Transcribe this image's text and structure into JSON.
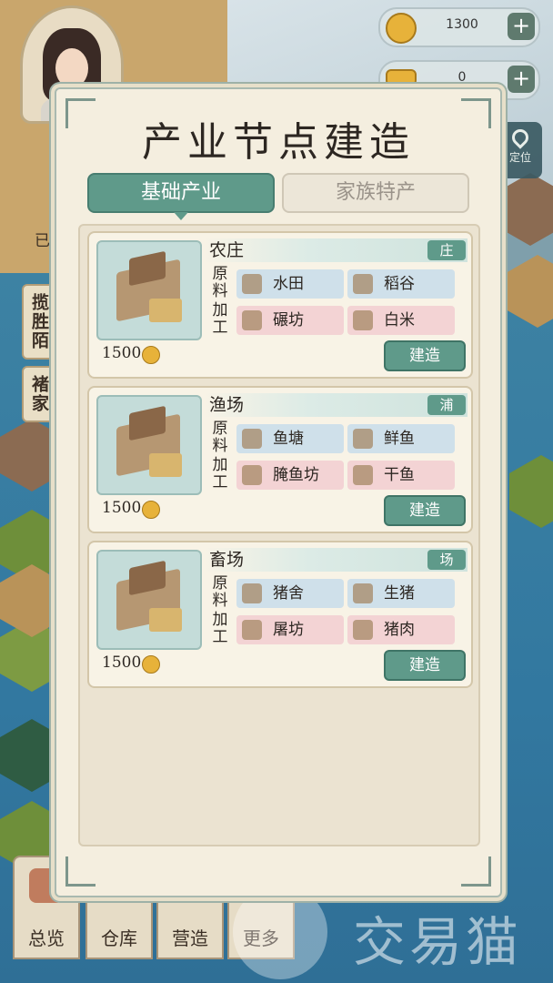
{
  "resources": {
    "coins": "1300",
    "ingots": "0",
    "plus": "+"
  },
  "map": {
    "locate_label": "定位",
    "side_tags": [
      "揽胜陌",
      "褚家"
    ],
    "partial_label": "已"
  },
  "nav": {
    "overview": "总览",
    "warehouse": "仓库",
    "construct": "营造",
    "more": "更多"
  },
  "watermark": "交易猫",
  "modal": {
    "title": "产业节点建造",
    "tabs": [
      {
        "label": "基础产业",
        "active": true
      },
      {
        "label": "家族特产",
        "active": false
      }
    ],
    "raw_label": "原料",
    "process_label": "加工",
    "build_label": "建造",
    "cards": [
      {
        "name": "农庄",
        "badge": "庄",
        "cost": "1500",
        "raw": [
          {
            "name": "水田",
            "icon": "paddy-icon"
          },
          {
            "name": "稻谷",
            "icon": "rice-grain-icon"
          }
        ],
        "process": [
          {
            "name": "碾坊",
            "icon": "mill-icon"
          },
          {
            "name": "白米",
            "icon": "rice-sack-icon"
          }
        ]
      },
      {
        "name": "渔场",
        "badge": "浦",
        "cost": "1500",
        "raw": [
          {
            "name": "鱼塘",
            "icon": "pond-icon"
          },
          {
            "name": "鲜鱼",
            "icon": "fish-icon"
          }
        ],
        "process": [
          {
            "name": "腌鱼坊",
            "icon": "curing-house-icon"
          },
          {
            "name": "干鱼",
            "icon": "dried-fish-icon"
          }
        ]
      },
      {
        "name": "畜场",
        "badge": "场",
        "cost": "1500",
        "raw": [
          {
            "name": "猪舍",
            "icon": "pigsty-icon"
          },
          {
            "name": "生猪",
            "icon": "pig-icon"
          }
        ],
        "process": [
          {
            "name": "屠坊",
            "icon": "butcher-icon"
          },
          {
            "name": "猪肉",
            "icon": "pork-icon"
          }
        ]
      }
    ]
  }
}
